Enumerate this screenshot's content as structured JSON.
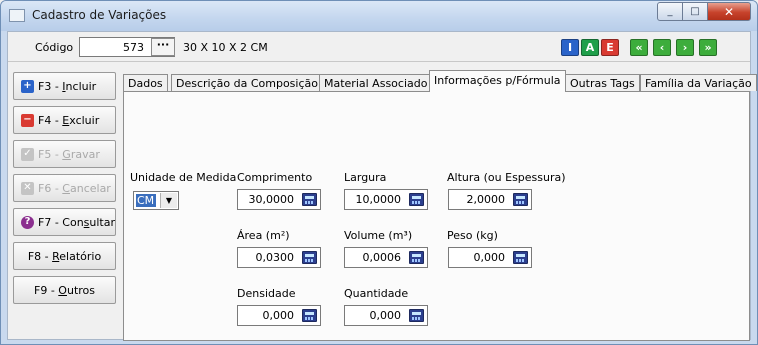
{
  "window": {
    "title": "Cadastro de Variações",
    "minimize": "_",
    "maximize": "□",
    "close": "✕"
  },
  "codebar": {
    "label": "Código",
    "value": "573",
    "lookup_button": "···",
    "description": "30 X 10 X 2 CM",
    "mode_buttons": [
      "I",
      "A",
      "E"
    ],
    "nav_buttons": [
      "«",
      "‹",
      "›",
      "»"
    ]
  },
  "sidebar": {
    "buttons": [
      {
        "pre": "F3 - ",
        "u": "I",
        "post": "ncluir",
        "icon": "+",
        "color": "#2a63c9"
      },
      {
        "pre": "F4 - ",
        "u": "E",
        "post": "xcluir",
        "icon": "−",
        "color": "#d93a32"
      },
      {
        "pre": "F5 - ",
        "u": "G",
        "post": "ravar",
        "icon": "✓",
        "color": "#c4c4c4"
      },
      {
        "pre": "F6 - ",
        "u": "C",
        "post": "ancelar",
        "icon": "✕",
        "color": "#c4c4c4"
      },
      {
        "pre": "F7 - Con",
        "u": "s",
        "post": "ultar",
        "icon": "?",
        "color": "#8b2f8f"
      },
      {
        "pre": "F8 - ",
        "u": "R",
        "post": "elatório"
      },
      {
        "pre": "F9 - ",
        "u": "O",
        "post": "utros"
      }
    ]
  },
  "tabs": [
    "Dados",
    "Descrição da Composição",
    "Material Associado",
    "Informações p/Fórmula",
    "Outras Tags",
    "Família da Variação"
  ],
  "form": {
    "unidade_label": "Unidade de Medida",
    "unidade_value": "CM",
    "comprimento_label": "Comprimento",
    "comprimento_value": "30,0000",
    "largura_label": "Largura",
    "largura_value": "10,0000",
    "altura_label": "Altura (ou Espessura)",
    "altura_value": "2,0000",
    "area_label": "Área (m²)",
    "area_value": "0,0300",
    "volume_label": "Volume (m³)",
    "volume_value": "0,0006",
    "peso_label": "Peso (kg)",
    "peso_value": "0,000",
    "densidade_label": "Densidade",
    "densidade_value": "0,000",
    "quantidade_label": "Quantidade",
    "quantidade_value": "0,000"
  }
}
